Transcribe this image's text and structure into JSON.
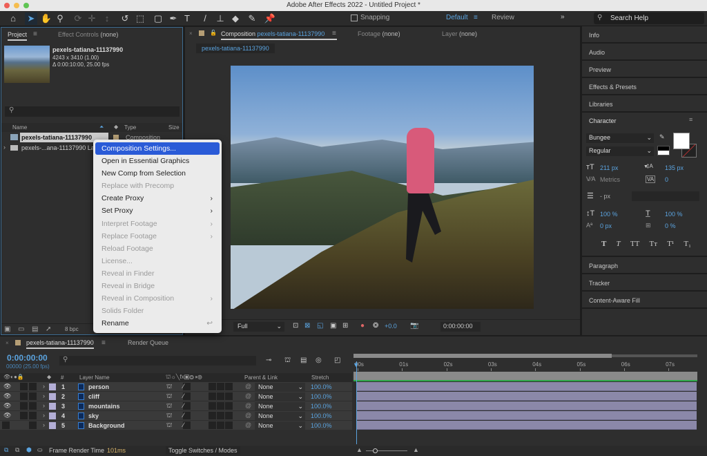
{
  "window": {
    "title": "Adobe After Effects 2022 - Untitled Project *"
  },
  "toolbar": {
    "snapping": "Snapping",
    "workspaces": [
      "Default",
      "Review"
    ],
    "search_placeholder": "Search Help"
  },
  "project": {
    "tab": "Project",
    "effect_controls": "Effect Controls",
    "effect_controls_value": "(none)",
    "item_name": "pexels-tatiana-11137990",
    "item_dims": "4243 x 3410 (1.00)",
    "item_duration": "Δ 0:00:10:00, 25.00 fps",
    "columns": {
      "name": "Name",
      "type": "Type",
      "size": "Size"
    },
    "items": [
      {
        "name": "pexels-tatiana-11137990",
        "type": "Composition"
      },
      {
        "name": "pexels-...ana-11137990 La"
      }
    ],
    "bpc": "8 bpc"
  },
  "context_menu": [
    {
      "label": "Composition Settings...",
      "state": "highlighted"
    },
    {
      "label": "Open in Essential Graphics"
    },
    {
      "label": "New Comp from Selection"
    },
    {
      "label": "Replace with Precomp",
      "state": "disabled"
    },
    {
      "label": "Create Proxy",
      "submenu": true
    },
    {
      "label": "Set Proxy",
      "submenu": true
    },
    {
      "label": "Interpret Footage",
      "state": "disabled",
      "submenu": true
    },
    {
      "label": "Replace Footage",
      "state": "disabled",
      "submenu": true
    },
    {
      "label": "Reload Footage",
      "state": "disabled"
    },
    {
      "label": "License...",
      "state": "disabled"
    },
    {
      "label": "Reveal in Finder",
      "state": "disabled"
    },
    {
      "label": "Reveal in Bridge",
      "state": "disabled"
    },
    {
      "label": "Reveal in Composition",
      "state": "disabled",
      "submenu": true
    },
    {
      "label": "Solids Folder",
      "state": "disabled"
    },
    {
      "label": "Rename",
      "shortcut": "↩"
    }
  ],
  "composition": {
    "tab_label": "Composition",
    "comp_name": "pexels-tatiana-11137990",
    "footage": "Footage",
    "footage_value": "(none)",
    "layer": "Layer",
    "layer_value": "(none)",
    "breadcrumb": "pexels-tatiana-11137990",
    "resolution": "Full",
    "exposure": "+0.0",
    "timecode": "0:00:00:00"
  },
  "right_panels": [
    "Info",
    "Audio",
    "Preview",
    "Effects & Presets",
    "Libraries"
  ],
  "character": {
    "title": "Character",
    "font": "Bungee",
    "style": "Regular",
    "size": "211 px",
    "leading": "135 px",
    "kerning": "Metrics",
    "tracking": "0",
    "stroke": "- px",
    "vscale": "100 %",
    "hscale": "100 %",
    "baseline": "0 px",
    "tsume": "0 %",
    "styles": [
      "T",
      "T",
      "TT",
      "Tт",
      "T¹",
      "T₁"
    ]
  },
  "right_panels_bottom": [
    "Paragraph",
    "Tracker",
    "Content-Aware Fill"
  ],
  "timeline": {
    "tab": "pexels-tatiana-11137990",
    "render_queue": "Render Queue",
    "timecode": "0:00:00:00",
    "frames": "00000 (25.00 fps)",
    "columns": {
      "num": "#",
      "layer_name": "Layer Name",
      "parent": "Parent & Link",
      "stretch": "Stretch"
    },
    "layers": [
      {
        "num": "1",
        "name": "person",
        "parent": "None",
        "stretch": "100.0%",
        "visible": true
      },
      {
        "num": "2",
        "name": "cliff",
        "parent": "None",
        "stretch": "100.0%",
        "visible": true
      },
      {
        "num": "3",
        "name": "mountains",
        "parent": "None",
        "stretch": "100.0%",
        "visible": true
      },
      {
        "num": "4",
        "name": "sky",
        "parent": "None",
        "stretch": "100.0%",
        "visible": true
      },
      {
        "num": "5",
        "name": "Background",
        "parent": "None",
        "stretch": "100.0%",
        "visible": false
      }
    ],
    "ruler": [
      "00s",
      "01s",
      "02s",
      "03s",
      "04s",
      "05s",
      "06s",
      "07s"
    ],
    "frame_render_label": "Frame Render Time",
    "frame_render_value": "101ms",
    "toggle": "Toggle Switches / Modes"
  },
  "colors": {
    "accent": "#5ba4e0",
    "highlight": "#2a5bd7",
    "label": "#b3aed6",
    "track": "#8b88a9"
  }
}
